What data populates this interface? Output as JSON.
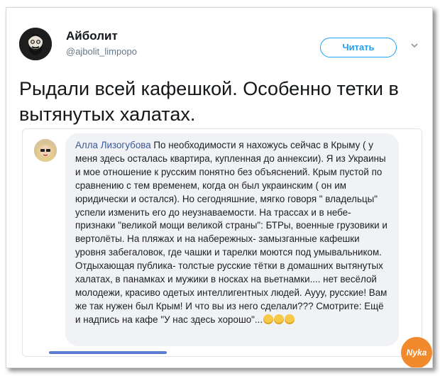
{
  "tweet": {
    "display_name": "Айболит",
    "handle": "@ajbolit_limpopo",
    "follow_label": "Читать",
    "text": "Рыдали всей кафешкой. Особенно тетки в вытянутых халатах."
  },
  "embedded_post": {
    "author": "Алла Лизогубова",
    "text": " По необходимости я нахожусь сейчас в Крыму ( у меня здесь осталась квартира, купленная до аннексии). Я из Украины и мое отношение к русским понятно без объяснений. Крым пустой по сравнению с тем временем, когда он был украинским ( он им юридически и остался). Но сегодняшние, мягко говоря \" владельцы\" успели изменить его до неузнаваемости. На трассах и в небе- признаки \"великой мощи великой страны\": БТРы, военные грузовики и вертолёты. На пляжах и на набережных- замызганные кафешки уровня забегаловок, где чашки и тарелки моются под умывальником. Отдыхающая публика- толстые русские тётки в домашних вытянутых халатах, в панамках и мужики в носках на вьетнамки.... нет весёлой молодежи, красиво одетых интеллигентных людей. Аууу, русские! Вам же так нужен был Крым! И что вы из него сделали??? Смотрите: Ещё и надпись на кафе \"У нас здесь хорошо\"...",
    "emoji_count": 3
  },
  "watermark_text": "Nyka",
  "colors": {
    "link_blue": "#1da1f2",
    "fb_name": "#385898",
    "bubble_bg": "#f1f2f6"
  }
}
